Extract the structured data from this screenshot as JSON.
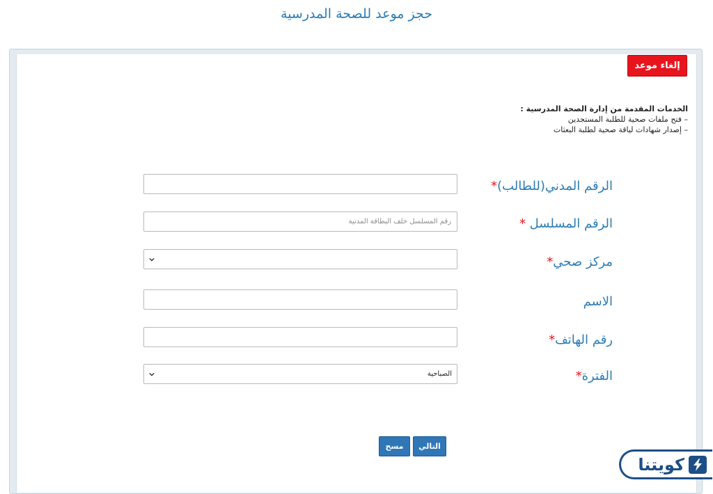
{
  "page": {
    "title": "حجز موعد للصحة المدرسية"
  },
  "actions": {
    "cancel_label": "إلغاء موعد"
  },
  "services": {
    "heading": "الخدمات المقدمة من إدارة الصحة المدرسية :",
    "items": [
      "– فتح ملفات صحية للطلبة المستجدين",
      "– إصدار شهادات لياقة صحية لطلبة البعثات"
    ]
  },
  "form": {
    "civil_id": {
      "label": "الرقم المدني(للطالب)",
      "required_mark": "*",
      "value": ""
    },
    "serial": {
      "label": "الرقم المسلسل",
      "required_mark": "*",
      "placeholder": "رقم المسلسل خلف البطاقة المدنية"
    },
    "health_center": {
      "label": "مركز صحي",
      "required_mark": "*",
      "selected": ""
    },
    "name": {
      "label": "الاسم",
      "value": ""
    },
    "phone": {
      "label": "رقم الهاتف",
      "required_mark": "*",
      "value": ""
    },
    "period": {
      "label": "الفترة",
      "required_mark": "*",
      "selected": "الصباحية"
    }
  },
  "buttons": {
    "next_label": "التالي",
    "clear_label": "مسح"
  },
  "brand": {
    "name": "كويتنا",
    "color": "#1d4e86"
  },
  "colors": {
    "accent": "#2a7bb5",
    "danger": "#e8141d",
    "button": "#2f77b6"
  }
}
